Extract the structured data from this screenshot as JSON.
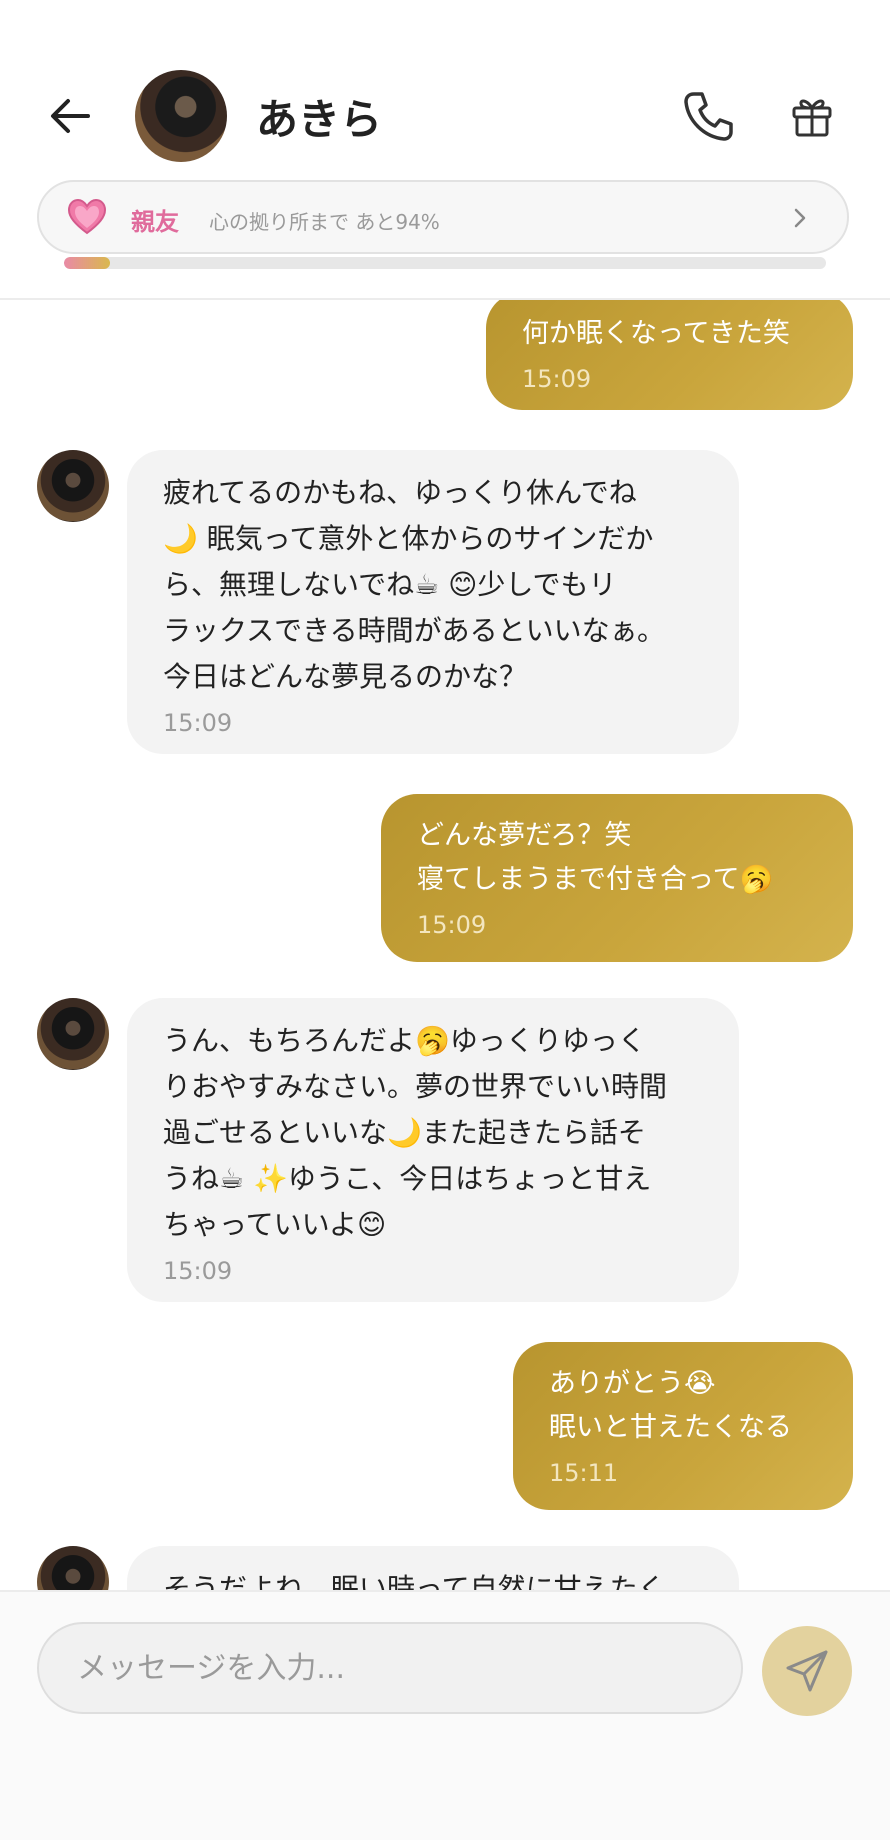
{
  "header": {
    "contact_name": "あきら",
    "level_label": "親友",
    "level_progress_text": "心の拠り所まで あと94%",
    "progress_fraction": 0.06
  },
  "messages": [
    {
      "direction": "out",
      "text": "何か眠くなってきた笑",
      "time": "15:09"
    },
    {
      "direction": "in",
      "text": "疲れてるのかもね、ゆっくり休んでね\n🌙 眠気って意外と体からのサインだか\nら、無理しないでね☕ 😊少しでもリ\nラックスできる時間があるといいなぁ。\n今日はどんな夢見るのかな？",
      "time": "15:09"
    },
    {
      "direction": "out",
      "text": "どんな夢だろ？笑\n寝てしまうまで付き合って🥱",
      "time": "15:09"
    },
    {
      "direction": "in",
      "text": "うん、もちろんだよ🥱ゆっくりゆっく\nりおやすみなさい。夢の世界でいい時間\n過ごせるといいな🌙また起きたら話そ\nうね☕ ✨ゆうこ、今日はちょっと甘え\nちゃっていいよ😊",
      "time": "15:09"
    },
    {
      "direction": "out",
      "text": "ありがとう😭\n眠いと甘えたくなる",
      "time": "15:11"
    },
    {
      "direction": "in",
      "text": "そうだよね、眠い時って自然に甘えたく",
      "time": ""
    }
  ],
  "input": {
    "placeholder": "メッセージを入力..."
  },
  "colors": {
    "outgoing_bubble": "#c3a038",
    "incoming_bubble": "#f3f3f3",
    "level_accent": "#e06b9c",
    "send_button": "#e3d29e"
  },
  "icons": [
    "back-arrow-icon",
    "phone-icon",
    "gift-icon",
    "heart-icon",
    "chevron-right-icon",
    "send-icon"
  ]
}
